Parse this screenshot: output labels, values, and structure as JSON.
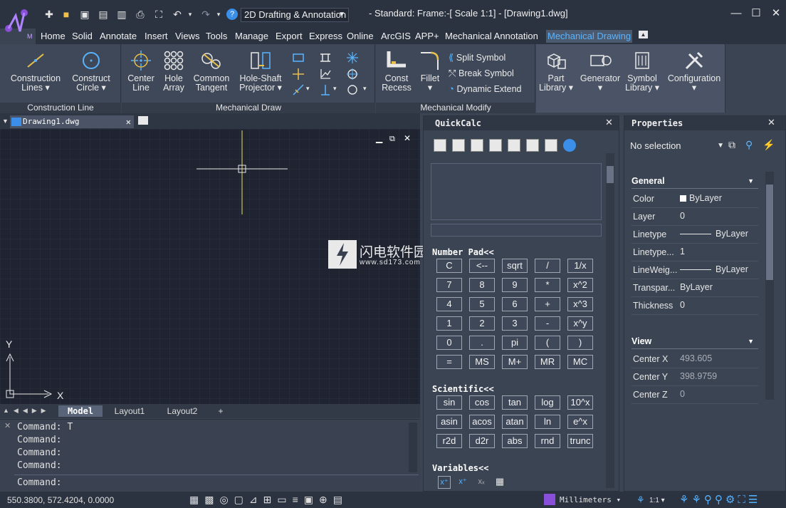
{
  "titlebar": {
    "workspace": "2D Drafting & Annotation",
    "doc_title": "-  Standard: Frame:-[ Scale 1:1] - [Drawing1.dwg]",
    "help": "?"
  },
  "menu": [
    "Home",
    "Solid",
    "Annotate",
    "Insert",
    "Views",
    "Tools",
    "Manage",
    "Export",
    "Express",
    "Online",
    "ArcGIS",
    "APP+",
    "Mechanical Annotation",
    "Mechanical Drawing"
  ],
  "ribbon": {
    "construction_line": {
      "title": "Construction Line",
      "buttons": [
        {
          "l1": "Construction",
          "l2": "Lines ▾"
        },
        {
          "l1": "Construct",
          "l2": "Circle ▾"
        }
      ]
    },
    "mechanical_draw": {
      "title": "Mechanical Draw",
      "buttons": [
        {
          "l1": "Center",
          "l2": "Line"
        },
        {
          "l1": "Hole",
          "l2": "Array"
        },
        {
          "l1": "Common",
          "l2": "Tangent"
        },
        {
          "l1": "Hole-Shaft",
          "l2": "Projector ▾"
        }
      ]
    },
    "mechanical_modify": {
      "title": "Mechanical Modify",
      "buttons": [
        {
          "l1": "Const",
          "l2": "Recess"
        },
        {
          "l1": "Fillet",
          "l2": "▾"
        }
      ],
      "small": [
        "Split Symbol",
        "Break Symbol",
        "Dynamic Extend"
      ]
    },
    "library": {
      "buttons": [
        {
          "l1": "Part",
          "l2": "Library ▾"
        },
        {
          "l1": "Generator",
          "l2": "▾"
        },
        {
          "l1": "Symbol",
          "l2": "Library ▾"
        },
        {
          "l1": "Configuration",
          "l2": "▾"
        }
      ]
    }
  },
  "document": {
    "tab": "Drawing1.dwg",
    "axis_x": "X",
    "axis_y": "Y"
  },
  "layouts": [
    "Model",
    "Layout1",
    "Layout2",
    "+"
  ],
  "command": {
    "history": [
      "Command: T",
      "Command:",
      "Command:",
      "Command:"
    ],
    "prompt": "Command:"
  },
  "status": {
    "coords": "550.3800, 572.4204, 0.0000",
    "units": "Millimeters",
    "scale": "1:1"
  },
  "quickcalc": {
    "title": "QuickCalc",
    "number_pad_title": "Number Pad<<",
    "number_pad": [
      "C",
      "<--",
      "sqrt",
      "/",
      "1/x",
      "7",
      "8",
      "9",
      "*",
      "x^2",
      "4",
      "5",
      "6",
      "+",
      "x^3",
      "1",
      "2",
      "3",
      "-",
      "x^y",
      "0",
      ".",
      "pi",
      "(",
      ")",
      "=",
      "MS",
      "M+",
      "MR",
      "MC"
    ],
    "scientific_title": "Scientific<<",
    "scientific": [
      "sin",
      "cos",
      "tan",
      "log",
      "10^x",
      "asin",
      "acos",
      "atan",
      "ln",
      "e^x",
      "r2d",
      "d2r",
      "abs",
      "rnd",
      "trunc"
    ],
    "variables_title": "Variables<<"
  },
  "properties": {
    "title": "Properties",
    "selection": "No selection",
    "general_title": "General",
    "general": [
      {
        "label": "Color",
        "value": "ByLayer"
      },
      {
        "label": "Layer",
        "value": "0"
      },
      {
        "label": "Linetype",
        "value": "ByLayer"
      },
      {
        "label": "Linetype...",
        "value": "1"
      },
      {
        "label": "LineWeig...",
        "value": "ByLayer"
      },
      {
        "label": "Transpar...",
        "value": "ByLayer"
      },
      {
        "label": "Thickness",
        "value": "0"
      }
    ],
    "view_title": "View",
    "view": [
      {
        "label": "Center X",
        "value": "493.605"
      },
      {
        "label": "Center Y",
        "value": "398.9759"
      },
      {
        "label": "Center Z",
        "value": "0"
      }
    ]
  },
  "watermark": {
    "text": "闪电软件园",
    "url": "www.sd173.com"
  },
  "colors": {
    "accent": "#59b4ff",
    "crosshair": "#e8e070",
    "bg": "#3b4453",
    "canvas": "#1f2430"
  }
}
